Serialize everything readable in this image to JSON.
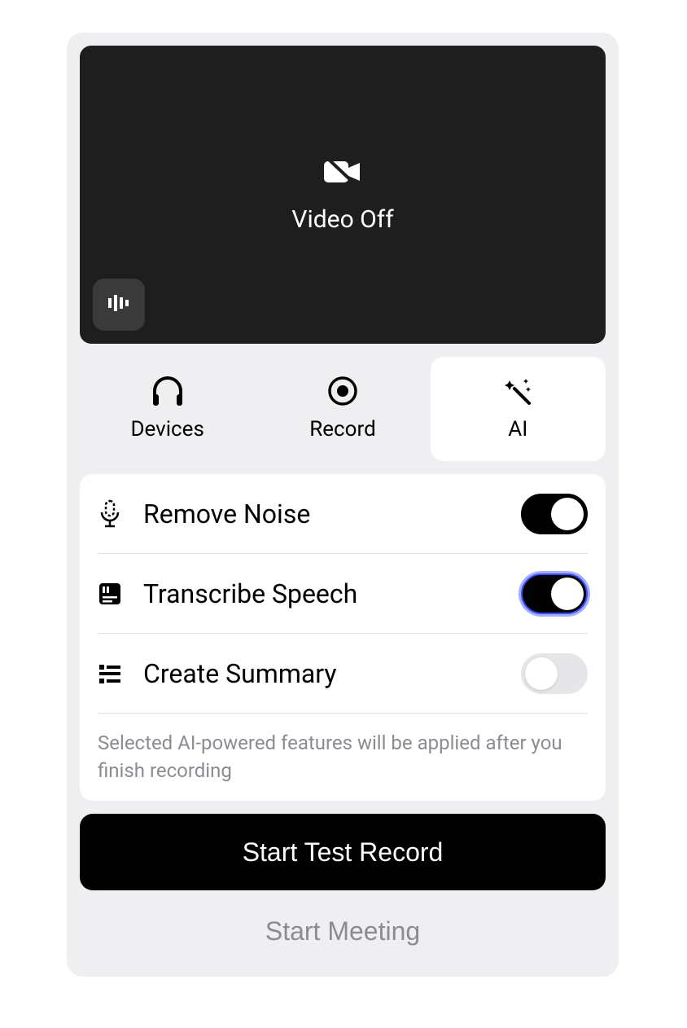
{
  "video": {
    "status_label": "Video Off"
  },
  "tabs": {
    "devices": {
      "label": "Devices"
    },
    "record": {
      "label": "Record"
    },
    "ai": {
      "label": "AI"
    },
    "selected": "ai"
  },
  "ai_options": {
    "remove_noise": {
      "label": "Remove Noise",
      "on": true,
      "focused": false
    },
    "transcribe_speech": {
      "label": "Transcribe Speech",
      "on": true,
      "focused": true
    },
    "create_summary": {
      "label": "Create Summary",
      "on": false,
      "focused": false
    }
  },
  "hint": "Selected AI-powered features will be applied after you finish recording",
  "buttons": {
    "start_test_record": "Start Test Record",
    "start_meeting": "Start Meeting"
  }
}
